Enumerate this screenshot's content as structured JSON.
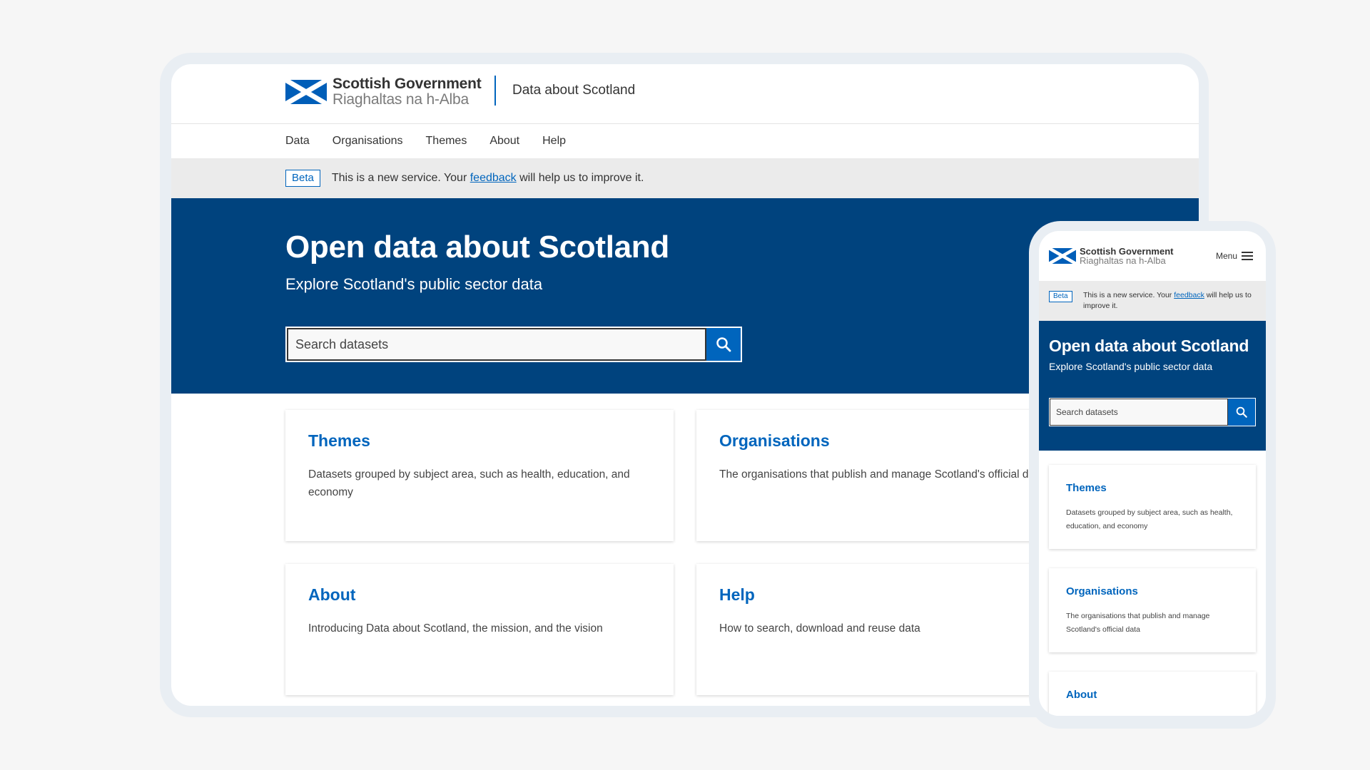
{
  "brand": {
    "name_en": "Scottish Government",
    "name_gd": "Riaghaltas na h-Alba",
    "site_title": "Data about Scotland",
    "accent_color": "#0065bd",
    "hero_color": "#00437e"
  },
  "nav": {
    "items": [
      {
        "label": "Data"
      },
      {
        "label": "Organisations"
      },
      {
        "label": "Themes"
      },
      {
        "label": "About"
      },
      {
        "label": "Help"
      }
    ],
    "mobile_menu_label": "Menu"
  },
  "beta_banner": {
    "tag": "Beta",
    "text_before": "This is a new service. Your ",
    "link": "feedback",
    "text_after": " will help us to improve it."
  },
  "hero": {
    "title": "Open data about Scotland",
    "subtitle": "Explore Scotland's public sector data",
    "search_placeholder": "Search datasets",
    "search_icon": "search-icon"
  },
  "cards": [
    {
      "title": "Themes",
      "description": "Datasets grouped by subject area, such as health, education, and economy"
    },
    {
      "title": "Organisations",
      "description": "The organisations that publish and manage Scotland's official data"
    },
    {
      "title": "About",
      "description": "Introducing Data about Scotland, the mission, and the vision"
    },
    {
      "title": "Help",
      "description": "How to search, download and reuse data"
    }
  ]
}
